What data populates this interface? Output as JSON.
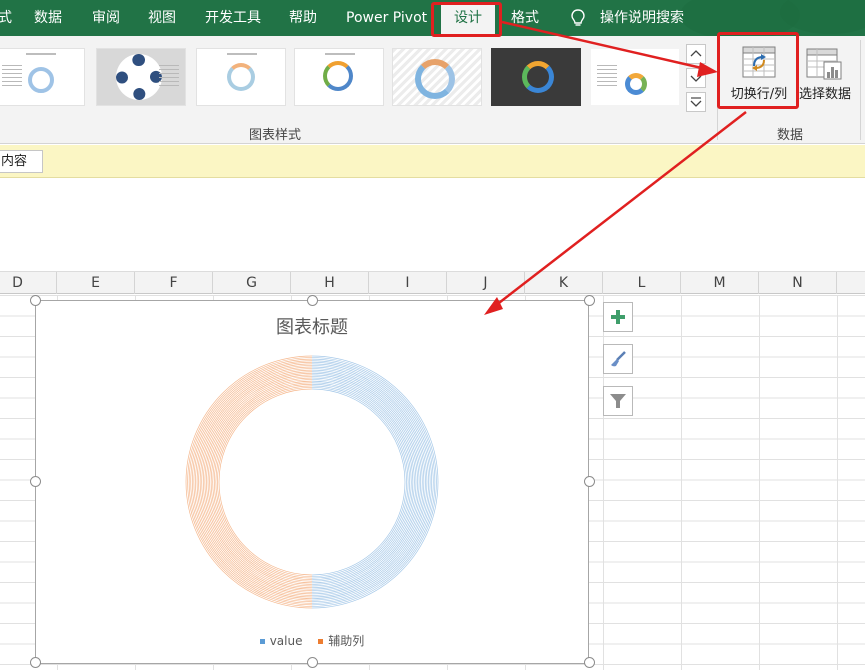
{
  "menu": {
    "items": [
      "式",
      "数据",
      "审阅",
      "视图",
      "开发工具",
      "帮助",
      "Power Pivot",
      "设计",
      "格式"
    ],
    "active_index": 7,
    "search_label": "操作说明搜索",
    "search_icon": "lightbulb-icon"
  },
  "ribbon": {
    "styles_group_label": "图表样式",
    "data_group_label": "数据",
    "switch_row_col_label": "切换行/列",
    "select_data_label": "选择数据",
    "switch_icon": "switch-row-column-icon",
    "select_data_icon": "select-data-table-icon"
  },
  "message_bar": {
    "box_text": "内容"
  },
  "columns": [
    "D",
    "E",
    "F",
    "G",
    "H",
    "I",
    "J",
    "K",
    "L",
    "M",
    "N"
  ],
  "chart": {
    "title": "图表标题",
    "legend": [
      {
        "name": "value",
        "color": "#5b9bd5"
      },
      {
        "name": "辅助列",
        "color": "#ed7d31"
      }
    ]
  },
  "chart_data": {
    "type": "pie",
    "title": "图表标题",
    "series": [
      {
        "name": "value",
        "values": [
          1
        ]
      },
      {
        "name": "辅助列",
        "values": [
          1
        ]
      }
    ],
    "legend_position": "bottom"
  },
  "chart_tools": [
    "plus-icon",
    "brush-icon",
    "filter-icon"
  ],
  "colors": {
    "accent_green": "#217346",
    "annotation_red": "#e02020",
    "series_blue": "#5b9bd5",
    "series_orange": "#ed7d31"
  }
}
